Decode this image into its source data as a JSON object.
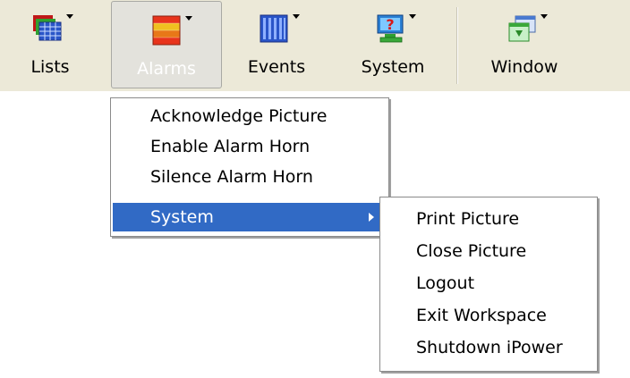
{
  "toolbar": {
    "buttons": [
      {
        "label": "Lists",
        "icon": "lists-icon"
      },
      {
        "label": "Alarms",
        "icon": "alarms-icon"
      },
      {
        "label": "Events",
        "icon": "events-icon"
      },
      {
        "label": "System",
        "icon": "system-icon"
      },
      {
        "label": "Window",
        "icon": "window-icon"
      }
    ],
    "active": "Alarms"
  },
  "alarms_menu": {
    "items": [
      {
        "label": "Acknowledge Picture"
      },
      {
        "label": "Enable Alarm Horn"
      },
      {
        "label": "Silence Alarm Horn"
      },
      {
        "label": "System",
        "has_submenu": true,
        "highlighted": true
      }
    ]
  },
  "system_submenu": {
    "items": [
      {
        "label": "Print Picture"
      },
      {
        "label": "Close Picture"
      },
      {
        "label": "Logout"
      },
      {
        "label": "Exit Workspace"
      },
      {
        "label": "Shutdown iPower"
      }
    ]
  },
  "colors": {
    "toolbar_bg": "#ece9d8",
    "highlight": "#316ac5",
    "active_button_bg": "#e3e2dc"
  }
}
